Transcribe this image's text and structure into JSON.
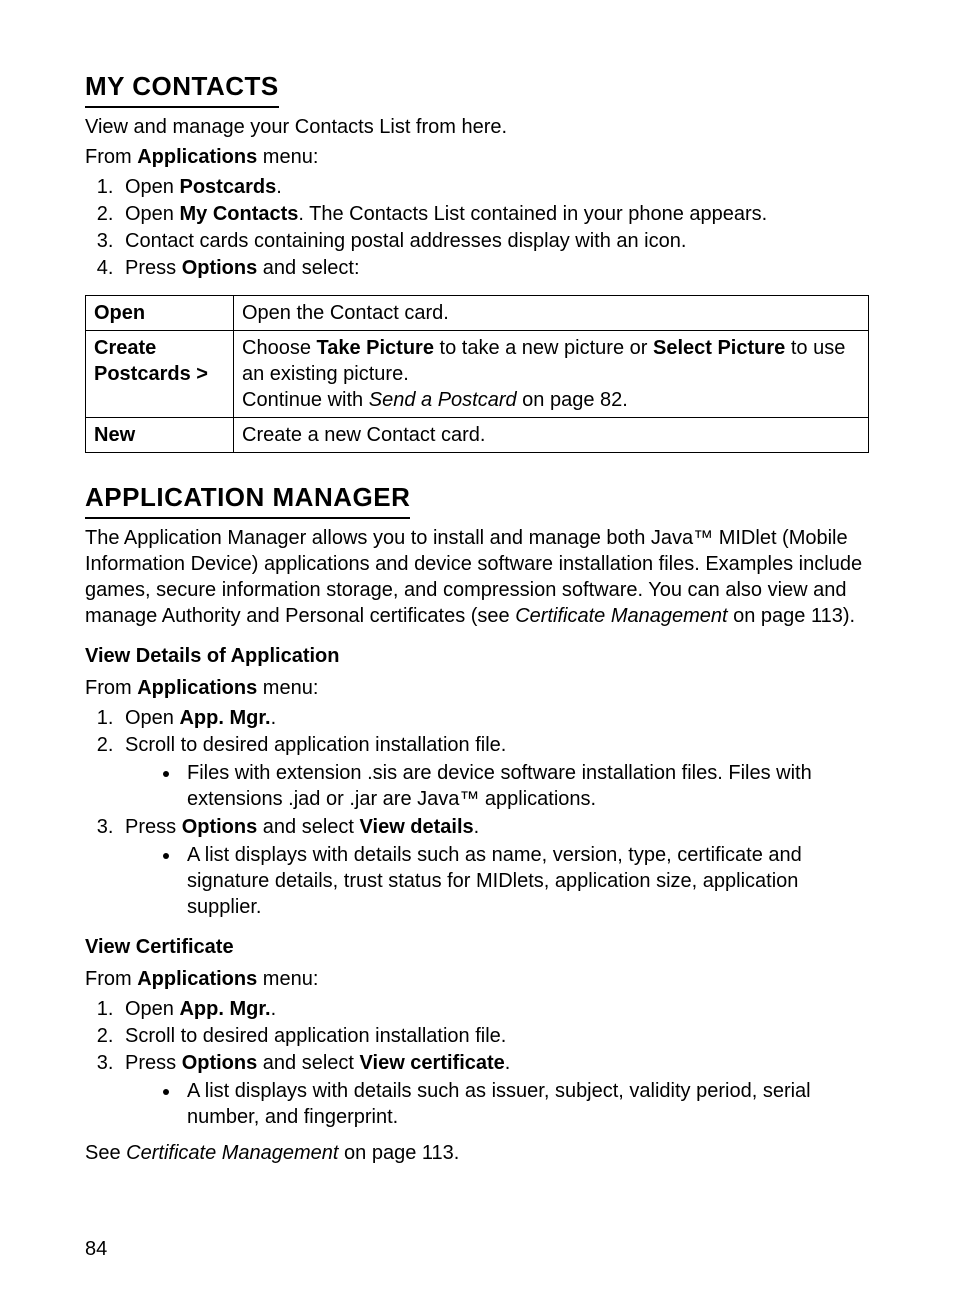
{
  "section1": {
    "title": "MY CONTACTS",
    "intro": "View and manage your Contacts List from here.",
    "fromPrefix": "From ",
    "fromBold": "Applications",
    "fromSuffix": " menu:",
    "step1_pre": "Open ",
    "step1_bold": "Postcards",
    "step1_post": ".",
    "step2_pre": "Open ",
    "step2_bold": "My Contacts",
    "step2_post": ". The Contacts List contained in your phone appears.",
    "step3": "Contact cards containing postal addresses display with an icon.",
    "step4_pre": "Press ",
    "step4_bold": "Options",
    "step4_post": " and select:",
    "table": {
      "r1c1": "Open",
      "r1c2": "Open the Contact card.",
      "r2c1": "Create Postcards >",
      "r2c2_pre": "Choose ",
      "r2c2_b1": "Take Picture",
      "r2c2_mid": " to take a new picture or ",
      "r2c2_b2": "Select Picture",
      "r2c2_post": " to use an existing picture.",
      "r2c2_line2_pre": "Continue with ",
      "r2c2_line2_i": "Send a Postcard",
      "r2c2_line2_post": " on page 82.",
      "r3c1": "New",
      "r3c2": "Create a new Contact card."
    }
  },
  "section2": {
    "title": "APPLICATION MANAGER",
    "intro_pre": "The Application Manager allows you to install and manage both Java™ MIDlet (Mobile Information Device) applications and device software installation files. Examples include games, secure information storage, and compression software. You can also view and manage Authority and Personal certificates (see ",
    "intro_i": "Certificate Management",
    "intro_post": " on page 113).",
    "sub1": {
      "title": "View Details of Application",
      "fromPrefix": "From ",
      "fromBold": "Applications",
      "fromSuffix": " menu:",
      "s1_pre": "Open ",
      "s1_bold": "App. Mgr.",
      "s1_post": ".",
      "s2": "Scroll to desired application installation file.",
      "s2_bullet": "Files with extension .sis are device software installation files. Files with extensions .jad or .jar are Java™ applications.",
      "s3_pre": "Press ",
      "s3_b1": "Options",
      "s3_mid": " and select ",
      "s3_b2": "View details",
      "s3_post": ".",
      "s3_bullet": "A list displays with details such as name, version, type, certificate and signature details, trust status for MIDlets, application size, application supplier."
    },
    "sub2": {
      "title": "View Certificate",
      "fromPrefix": "From ",
      "fromBold": "Applications",
      "fromSuffix": " menu:",
      "s1_pre": "Open ",
      "s1_bold": "App. Mgr.",
      "s1_post": ".",
      "s2": "Scroll to desired application installation file.",
      "s3_pre": "Press ",
      "s3_b1": "Options",
      "s3_mid": " and select ",
      "s3_b2": "View certificate",
      "s3_post": ".",
      "s3_bullet": "A list displays with details such as issuer, subject, validity period, serial number, and fingerprint.",
      "see_pre": "See ",
      "see_i": "Certificate Management",
      "see_post": " on page 113."
    }
  },
  "pageNumber": "84"
}
